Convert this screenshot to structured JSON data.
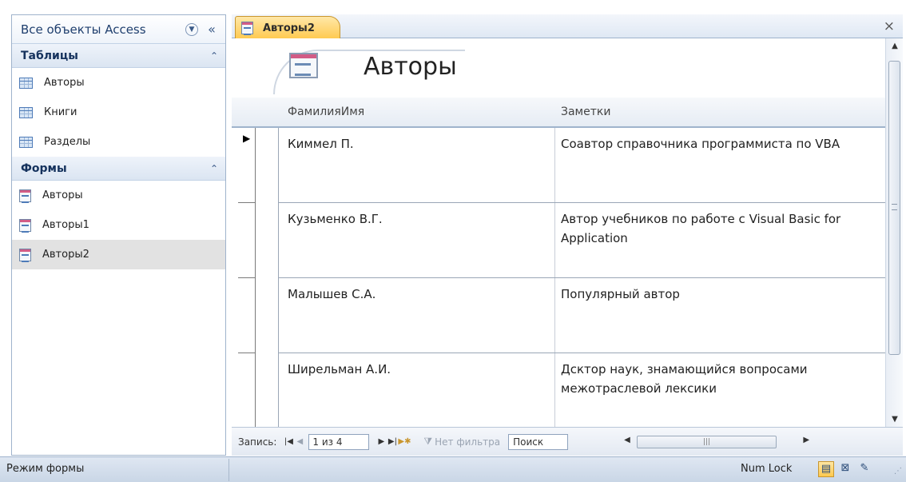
{
  "nav_pane": {
    "title": "Все объекты Access",
    "dropdown_icon": "dropdown-circle-icon",
    "collapse_icon": "double-chevron-left-icon",
    "groups": [
      {
        "label": "Таблицы",
        "items": [
          {
            "label": "Авторы",
            "icon": "table-icon"
          },
          {
            "label": "Книги",
            "icon": "table-icon"
          },
          {
            "label": "Разделы",
            "icon": "table-icon"
          }
        ]
      },
      {
        "label": "Формы",
        "items": [
          {
            "label": "Авторы",
            "icon": "form-icon"
          },
          {
            "label": "Авторы1",
            "icon": "form-icon"
          },
          {
            "label": "Авторы2",
            "icon": "form-icon",
            "selected": true
          }
        ]
      }
    ]
  },
  "document": {
    "tab_label": "Авторы2",
    "close_glyph": "×",
    "form_title": "Авторы",
    "columns": [
      "ФамилияИмя",
      "Заметки"
    ],
    "records": [
      {
        "name": "Киммел П.",
        "note": "Соавтор справочника программиста по VBA",
        "current": true
      },
      {
        "name": "Кузьменко В.Г.",
        "note": "Автор учебников по работе с Visual Basic for Application"
      },
      {
        "name": "Малышев С.А.",
        "note": "Популярный автор"
      },
      {
        "name": "Ширельман А.И.",
        "note": "Дсктор наук, знамающийся вопросами межотраслевой лексики"
      }
    ]
  },
  "record_nav": {
    "label": "Запись:",
    "counter": "1 из 4",
    "filter_label": "Нет фильтра",
    "search_label": "Поиск"
  },
  "status_bar": {
    "mode": "Режим формы",
    "num_lock": "Num Lock"
  },
  "colors": {
    "tab_active": "#ffc94e",
    "nav_border": "#9fb3cc",
    "form_icon_accent": "#d25c86"
  }
}
